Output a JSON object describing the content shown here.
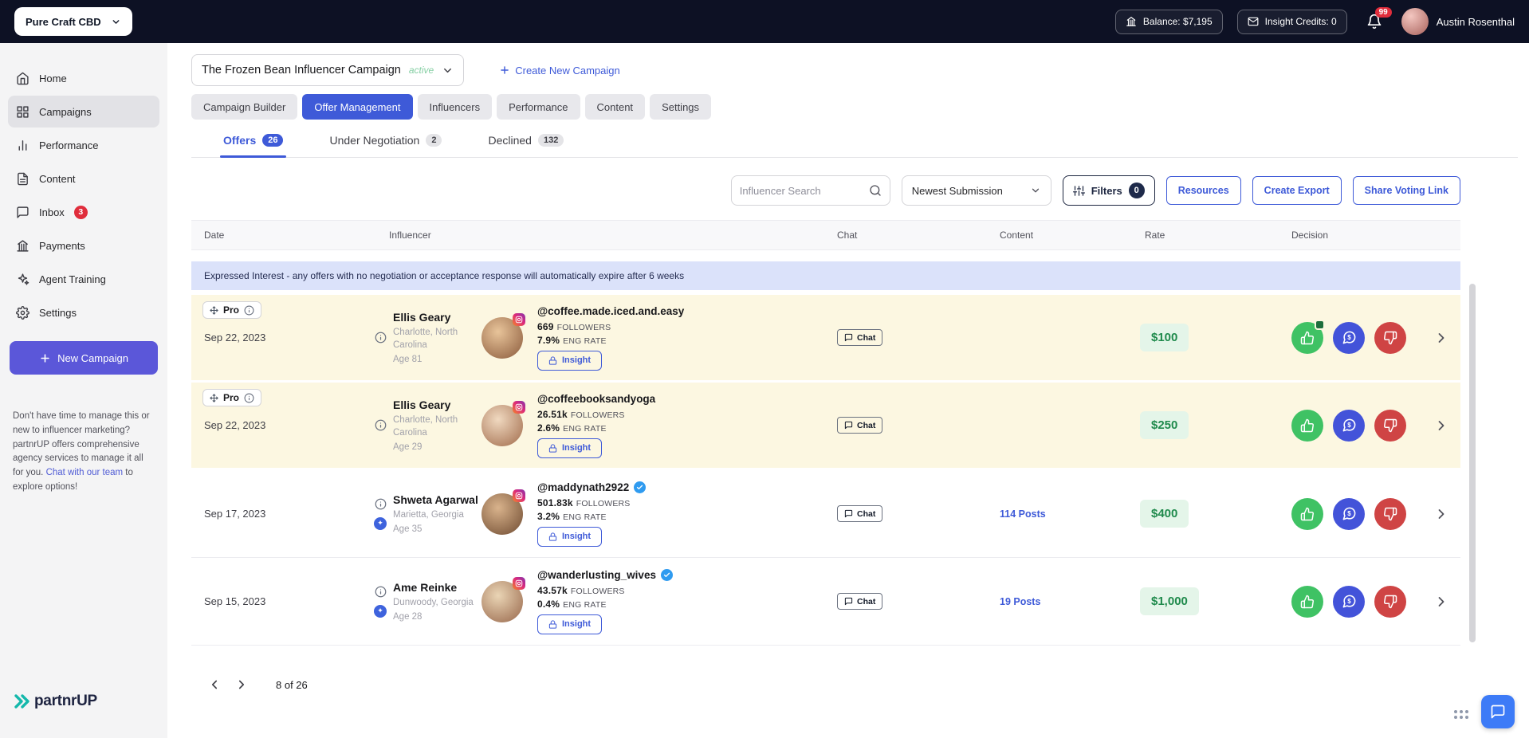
{
  "topbar": {
    "org": "Pure Craft CBD",
    "balance": "Balance: $7,195",
    "credits": "Insight Credits: 0",
    "bell_badge": "99",
    "user": "Austin Rosenthal"
  },
  "sidebar": {
    "items": [
      {
        "label": "Home"
      },
      {
        "label": "Campaigns"
      },
      {
        "label": "Performance"
      },
      {
        "label": "Content"
      },
      {
        "label": "Inbox",
        "badge": "3"
      },
      {
        "label": "Payments"
      },
      {
        "label": "Agent Training"
      },
      {
        "label": "Settings"
      }
    ],
    "new_campaign": "New Campaign",
    "promo_before": "Don't have time to manage this or new to influencer marketing? partnrUP offers comprehensive agency services to manage it all for you. ",
    "promo_link": "Chat with our team",
    "promo_after": " to explore options!",
    "logo": "partnrUP"
  },
  "campaign": {
    "name": "The Frozen Bean Influencer Campaign",
    "status": "active",
    "create_new": "Create New Campaign"
  },
  "tabs": [
    {
      "label": "Campaign Builder"
    },
    {
      "label": "Offer Management"
    },
    {
      "label": "Influencers"
    },
    {
      "label": "Performance"
    },
    {
      "label": "Content"
    },
    {
      "label": "Settings"
    }
  ],
  "subtabs": [
    {
      "label": "Offers",
      "count": "26"
    },
    {
      "label": "Under Negotiation",
      "count": "2"
    },
    {
      "label": "Declined",
      "count": "132"
    }
  ],
  "toolbar": {
    "search_placeholder": "Influencer Search",
    "sort_value": "Newest Submission",
    "filters_label": "Filters",
    "filters_count": "0",
    "resources": "Resources",
    "create_export": "Create Export",
    "share_voting": "Share Voting Link"
  },
  "table": {
    "headers": [
      "Date",
      "Influencer",
      "Chat",
      "Content",
      "Rate",
      "Decision"
    ],
    "banner": "Expressed Interest - any offers with no negotiation or acceptance response will automatically expire after 6 weeks",
    "labels": {
      "pro": "Pro",
      "insight": "Insight",
      "chat": "Chat",
      "followers": "FOLLOWERS",
      "eng_rate": "ENG RATE"
    },
    "rows": [
      {
        "date": "Sep 22, 2023",
        "pro": true,
        "highlight": true,
        "name": "Ellis Geary",
        "location": "Charlotte, North Carolina",
        "age": "Age 81",
        "handle": "@coffee.made.iced.and.easy",
        "verified": false,
        "boosted": false,
        "followers": "669",
        "eng_rate": "7.9%",
        "posts": "",
        "rate": "$100",
        "approve_note": true
      },
      {
        "date": "Sep 22, 2023",
        "pro": true,
        "highlight": true,
        "name": "Ellis Geary",
        "location": "Charlotte, North Carolina",
        "age": "Age 29",
        "handle": "@coffeebooksandyoga",
        "verified": false,
        "boosted": false,
        "followers": "26.51k",
        "eng_rate": "2.6%",
        "posts": "",
        "rate": "$250",
        "approve_note": false
      },
      {
        "date": "Sep 17, 2023",
        "pro": false,
        "highlight": false,
        "name": "Shweta Agarwal",
        "location": "Marietta, Georgia",
        "age": "Age 35",
        "handle": "@maddynath2922",
        "verified": true,
        "boosted": true,
        "followers": "501.83k",
        "eng_rate": "3.2%",
        "posts": "114 Posts",
        "rate": "$400",
        "approve_note": false
      },
      {
        "date": "Sep 15, 2023",
        "pro": false,
        "highlight": false,
        "name": "Ame Reinke",
        "location": "Dunwoody, Georgia",
        "age": "Age 28",
        "handle": "@wanderlusting_wives",
        "verified": true,
        "boosted": true,
        "followers": "43.57k",
        "eng_rate": "0.4%",
        "posts": "19 Posts",
        "rate": "$1,000",
        "approve_note": false
      }
    ]
  },
  "pagination": {
    "label": "8 of 26"
  },
  "colors": {
    "accent_blue": "#3e5ad8",
    "approve_green": "#3fc264",
    "negotiate_blue": "#4353d9",
    "decline_red": "#cf4444",
    "rate_green_bg": "#e4f5e9",
    "rate_green_text": "#1f8a4c",
    "highlight_row": "#fcf7e1",
    "banner_bg": "#dbe2fa",
    "new_campaign_purple": "#5b57d9",
    "topbar_bg": "#0d1124"
  }
}
